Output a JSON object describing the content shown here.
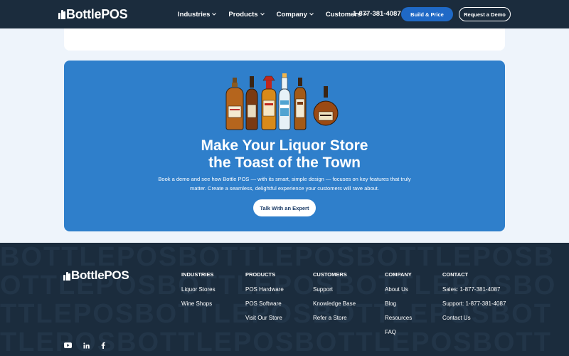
{
  "header": {
    "logo": "BottlePOS",
    "nav": [
      {
        "label": "Industries"
      },
      {
        "label": "Products"
      },
      {
        "label": "Company"
      },
      {
        "label": "Customers"
      }
    ],
    "phone": "1-877-381-4087",
    "build_label": "Build & Price",
    "demo_label": "Request a Demo"
  },
  "cta": {
    "title_line1": "Make Your Liquor Store",
    "title_line2": "the Toast of the Town",
    "description_line1": "Book a demo and see how Bottle POS — with its smart, simple design — focuses on key features that truly",
    "description_line2": "matter. Create a seamless, delightful experience your customers will rave about.",
    "button_label": "Talk With an Expert"
  },
  "footer": {
    "logo": "BottlePOS",
    "columns": [
      {
        "heading": "INDUSTRIES",
        "links": [
          "Liquor Stores",
          "Wine Shops"
        ]
      },
      {
        "heading": "PRODUCTS",
        "links": [
          "POS Hardware",
          "POS Software",
          "Visit Our Store"
        ]
      },
      {
        "heading": "CUSTOMERS",
        "links": [
          "Support",
          "Knowledge Base",
          "Refer a Store"
        ]
      },
      {
        "heading": "COMPANY",
        "links": [
          "About Us",
          "Blog",
          "Resources",
          "FAQ"
        ]
      },
      {
        "heading": "CONTACT",
        "links": [
          "Sales: 1-877-381-4087",
          "Support: 1-877-381-4087",
          "Contact Us"
        ]
      }
    ],
    "social": [
      "youtube-icon",
      "linkedin-icon",
      "facebook-icon"
    ]
  },
  "colors": {
    "header_bg": "#1b2c3d",
    "accent_blue": "#1f69c6",
    "cta_bg": "#2f7fcb",
    "page_bg": "#eef4fb"
  }
}
